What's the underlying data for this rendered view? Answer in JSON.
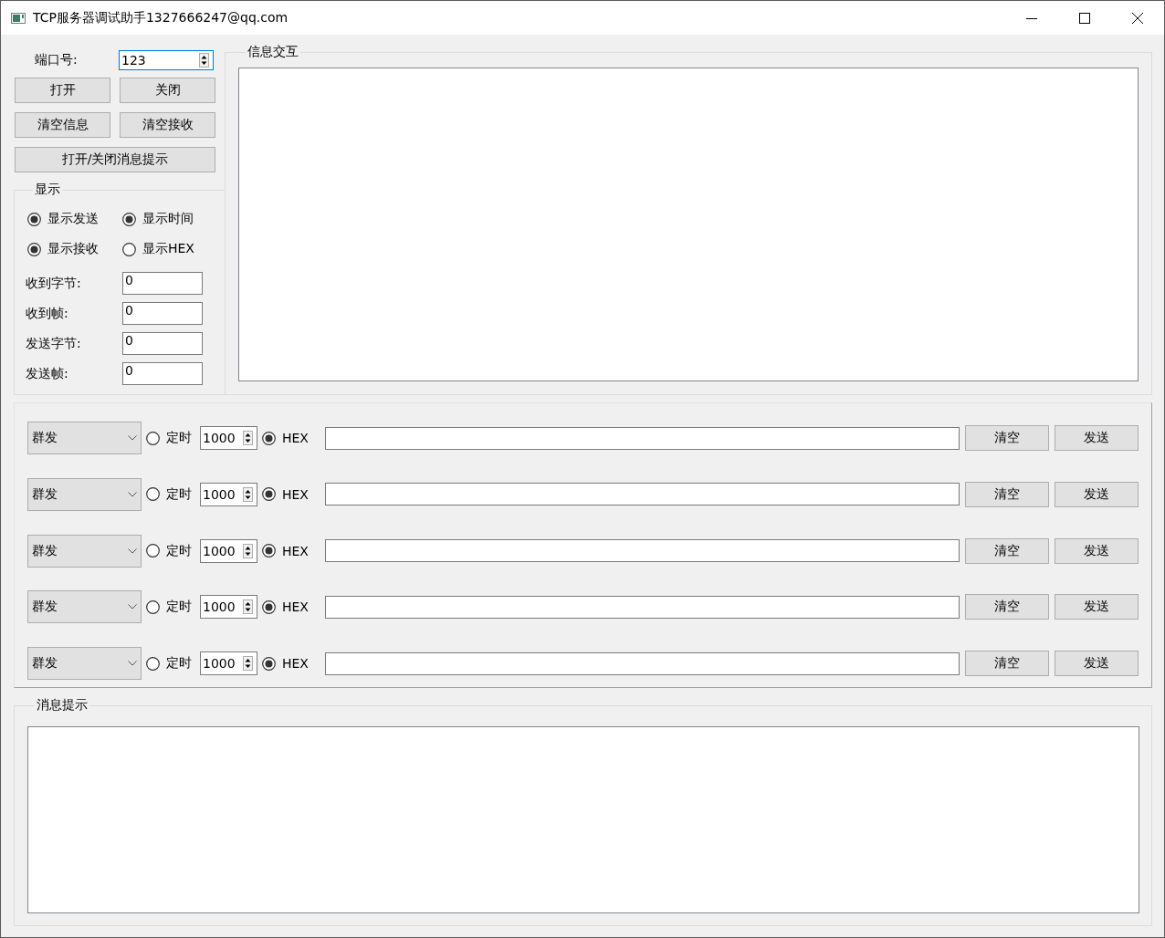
{
  "window": {
    "title": "TCP服务器调试助手1327666247@qq.com"
  },
  "port": {
    "label": "端口号:",
    "value": "123"
  },
  "buttons": [
    {
      "label": "打开"
    },
    {
      "label": "关闭"
    },
    {
      "label": "清空信息"
    },
    {
      "label": "清空接收"
    },
    {
      "label": "打开/关闭消息提示",
      "wide": true
    }
  ],
  "display": {
    "title": "显示",
    "options": [
      {
        "label": "显示发送",
        "checked": true
      },
      {
        "label": "显示时间",
        "checked": true
      },
      {
        "label": "显示接收",
        "checked": true
      },
      {
        "label": "显示HEX",
        "checked": false
      }
    ],
    "counters": [
      {
        "label": "收到字节:",
        "value": "0"
      },
      {
        "label": "收到帧:",
        "value": "0"
      },
      {
        "label": "发送字节:",
        "value": "0"
      },
      {
        "label": "发送帧:",
        "value": "0"
      }
    ]
  },
  "info": {
    "title": "信息交互"
  },
  "send_rows": [
    {
      "mode": "群发",
      "timer_label": "定时",
      "timer_checked": false,
      "interval": "1000",
      "hex_label": "HEX",
      "hex_checked": true,
      "clear": "清空",
      "send": "发送"
    },
    {
      "mode": "群发",
      "timer_label": "定时",
      "timer_checked": false,
      "interval": "1000",
      "hex_label": "HEX",
      "hex_checked": true,
      "clear": "清空",
      "send": "发送"
    },
    {
      "mode": "群发",
      "timer_label": "定时",
      "timer_checked": false,
      "interval": "1000",
      "hex_label": "HEX",
      "hex_checked": true,
      "clear": "清空",
      "send": "发送"
    },
    {
      "mode": "群发",
      "timer_label": "定时",
      "timer_checked": false,
      "interval": "1000",
      "hex_label": "HEX",
      "hex_checked": true,
      "clear": "清空",
      "send": "发送"
    },
    {
      "mode": "群发",
      "timer_label": "定时",
      "timer_checked": false,
      "interval": "1000",
      "hex_label": "HEX",
      "hex_checked": true,
      "clear": "清空",
      "send": "发送"
    }
  ],
  "messages": {
    "title": "消息提示"
  }
}
